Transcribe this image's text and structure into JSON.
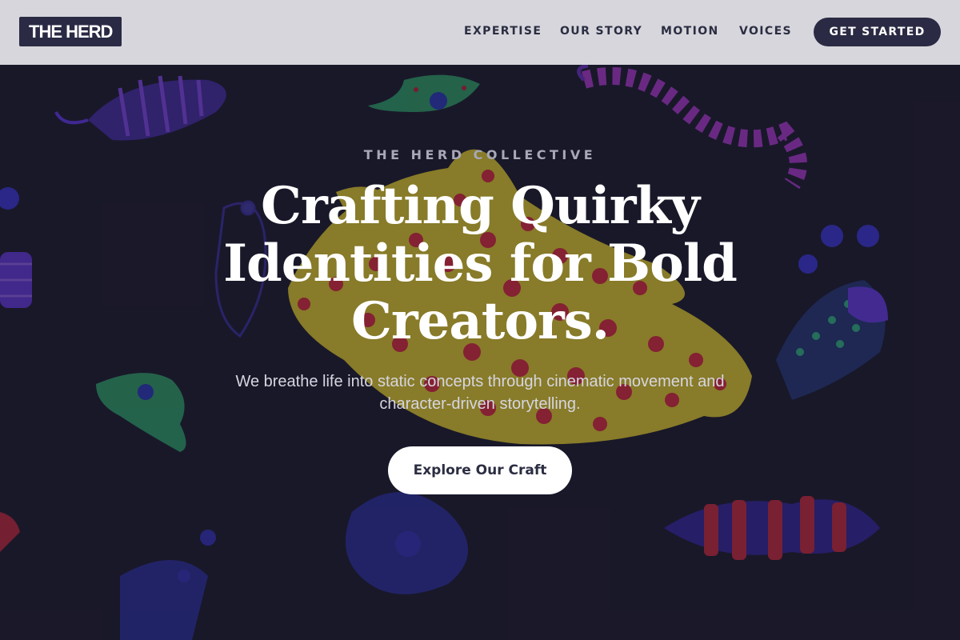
{
  "brand": {
    "logo_text": "THE HERD"
  },
  "nav": {
    "links": [
      {
        "label": "EXPERTISE"
      },
      {
        "label": "OUR STORY"
      },
      {
        "label": "MOTION"
      },
      {
        "label": "VOICES"
      }
    ],
    "cta_label": "GET STARTED"
  },
  "hero": {
    "eyebrow": "THE HERD COLLECTIVE",
    "headline": "Crafting Quirky Identities for Bold Creators.",
    "subcopy": "We breathe life into static concepts through cinematic movement and character-driven storytelling.",
    "cta_label": "Explore Our Craft"
  },
  "colors": {
    "navbar_bg": "#dedee4",
    "accent_dark": "#2a2a44",
    "hero_bg": "#1b1a2a",
    "text_light": "#ffffff"
  }
}
